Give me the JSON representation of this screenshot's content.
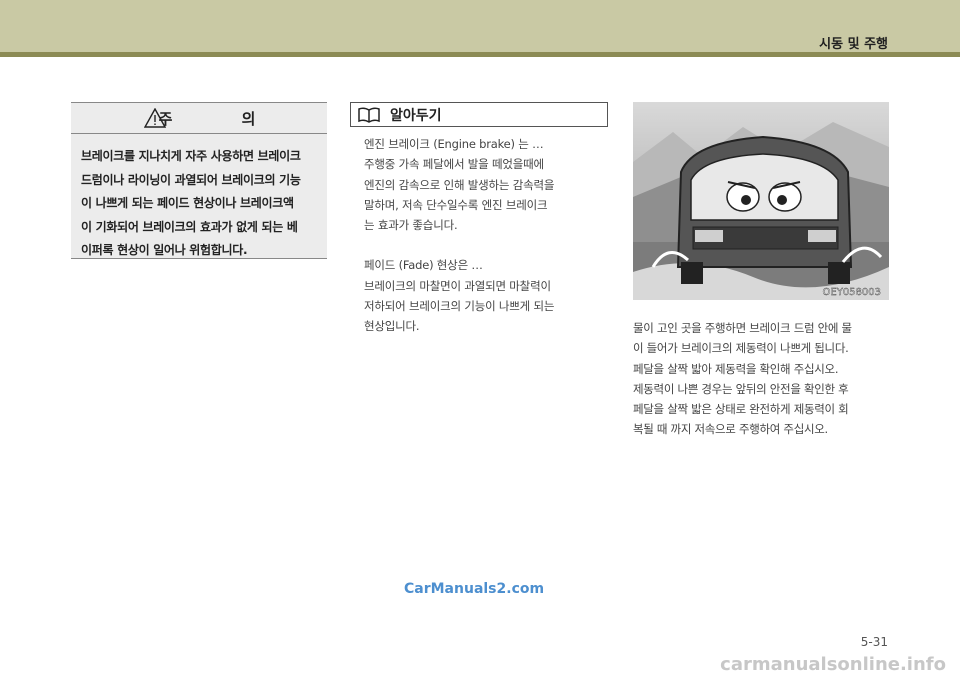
{
  "header": {
    "section_title": "시동 및 주행"
  },
  "caution": {
    "title": "주 의",
    "lines": [
      "브레이크를 지나치게 자주 사용하면 브레이크",
      "드럼이나 라이닝이 과열되어 브레이크의 기능",
      "이 나쁘게 되는 페이드 현상이나 브레이크액",
      "이 기화되어 브레이크의 효과가 없게 되는 베",
      "이퍼록 현상이 일어나 위험합니다."
    ]
  },
  "info": {
    "title": "알아두기",
    "para1": [
      "엔진 브레이크 (Engine brake) 는 …",
      "주행중 가속 페달에서 발을 떼었을때에",
      "엔진의 감속으로 인해 발생하는 감속력을",
      "말하며, 저속 단수일수록 엔진 브레이크",
      "는 효과가 좋습니다."
    ],
    "para2": [
      "페이드 (Fade) 현상은 …",
      "브레이크의 마찰면이 과열되면 마찰력이",
      "저하되어 브레이크의 기능이 나쁘게 되는",
      "현상입니다."
    ]
  },
  "figure": {
    "code": "OEY058003"
  },
  "right_text": [
    "물이 고인 곳을 주행하면 브레이크 드럼 안에 물",
    "이 들어가 브레이크의 제동력이 나쁘게 됩니다.",
    "페달을 살짝 밟아 제동력을 확인해 주십시오.",
    "제동력이 나쁜 경우는 앞뒤의 안전을 확인한 후",
    "페달을 살짝 밟은 상태로 완전하게 제동력이 회",
    "복될 때 까지 저속으로 주행하여 주십시오."
  ],
  "footer": {
    "watermark": "CarManuals2.com",
    "page_number": "5-31",
    "site": "carmanualsonline.info"
  }
}
